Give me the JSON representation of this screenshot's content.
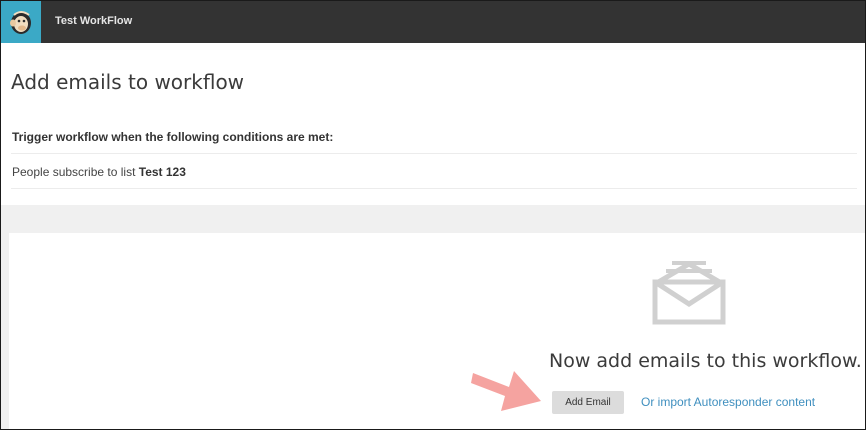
{
  "app": {
    "workflow_name": "Test WorkFlow"
  },
  "header": {
    "title": "Add emails to workflow",
    "trigger_label": "Trigger workflow when the following conditions are met:",
    "condition_prefix": "People subscribe to list",
    "condition_list": "Test 123"
  },
  "empty_state": {
    "heading": "Now add emails to this workflow.",
    "add_email_label": "Add Email",
    "import_link_label": "Or import Autoresponder content"
  },
  "icons": {
    "logo": "mailchimp-logo-icon",
    "empty": "envelope-icon",
    "annotation": "arrow-icon"
  },
  "colors": {
    "topbar": "#333333",
    "logo_bg": "#3ba9c6",
    "link": "#3f8fbf",
    "button_bg": "#dcdcdc",
    "arrow": "#f5a3a0"
  }
}
